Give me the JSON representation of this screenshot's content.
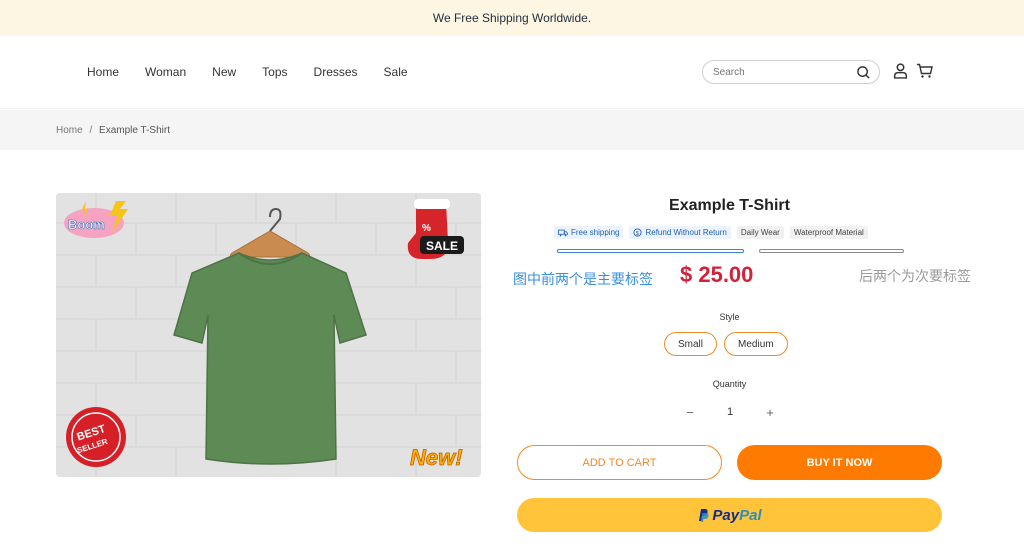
{
  "announcement": "We Free Shipping Worldwide.",
  "nav": [
    "Home",
    "Woman",
    "New",
    "Tops",
    "Dresses",
    "Sale"
  ],
  "search": {
    "placeholder": "Search"
  },
  "breadcrumb": {
    "home": "Home",
    "separator": "/",
    "current": "Example T-Shirt"
  },
  "product": {
    "title": "Example T-Shirt",
    "tags_primary": [
      "Free shipping",
      "Refund Without Return"
    ],
    "tags_secondary": [
      "Daily Wear",
      "Waterproof Material"
    ],
    "note_primary": "图中前两个是主要标签",
    "note_secondary": "后两个为次要标签",
    "price": "$ 25.00",
    "style_label": "Style",
    "styles": [
      "Small",
      "Medium"
    ],
    "quantity_label": "Quantity",
    "quantity": "1",
    "minus": "−",
    "plus": "+",
    "add_to_cart": "ADD TO CART",
    "buy_now": "BUY IT NOW",
    "paypal_a": "Pay",
    "paypal_b": "Pal",
    "stickers": {
      "boom": "Boom",
      "sale": "SALE",
      "percent": "%",
      "best": "BEST",
      "seller": "SELLER",
      "new": "New!"
    }
  },
  "colors": {
    "accent": "#ff7a00",
    "price": "#d3213a",
    "tag_blue": "#1e5fb4",
    "paypal": "#ffc439",
    "shirt": "#5e8a55"
  }
}
